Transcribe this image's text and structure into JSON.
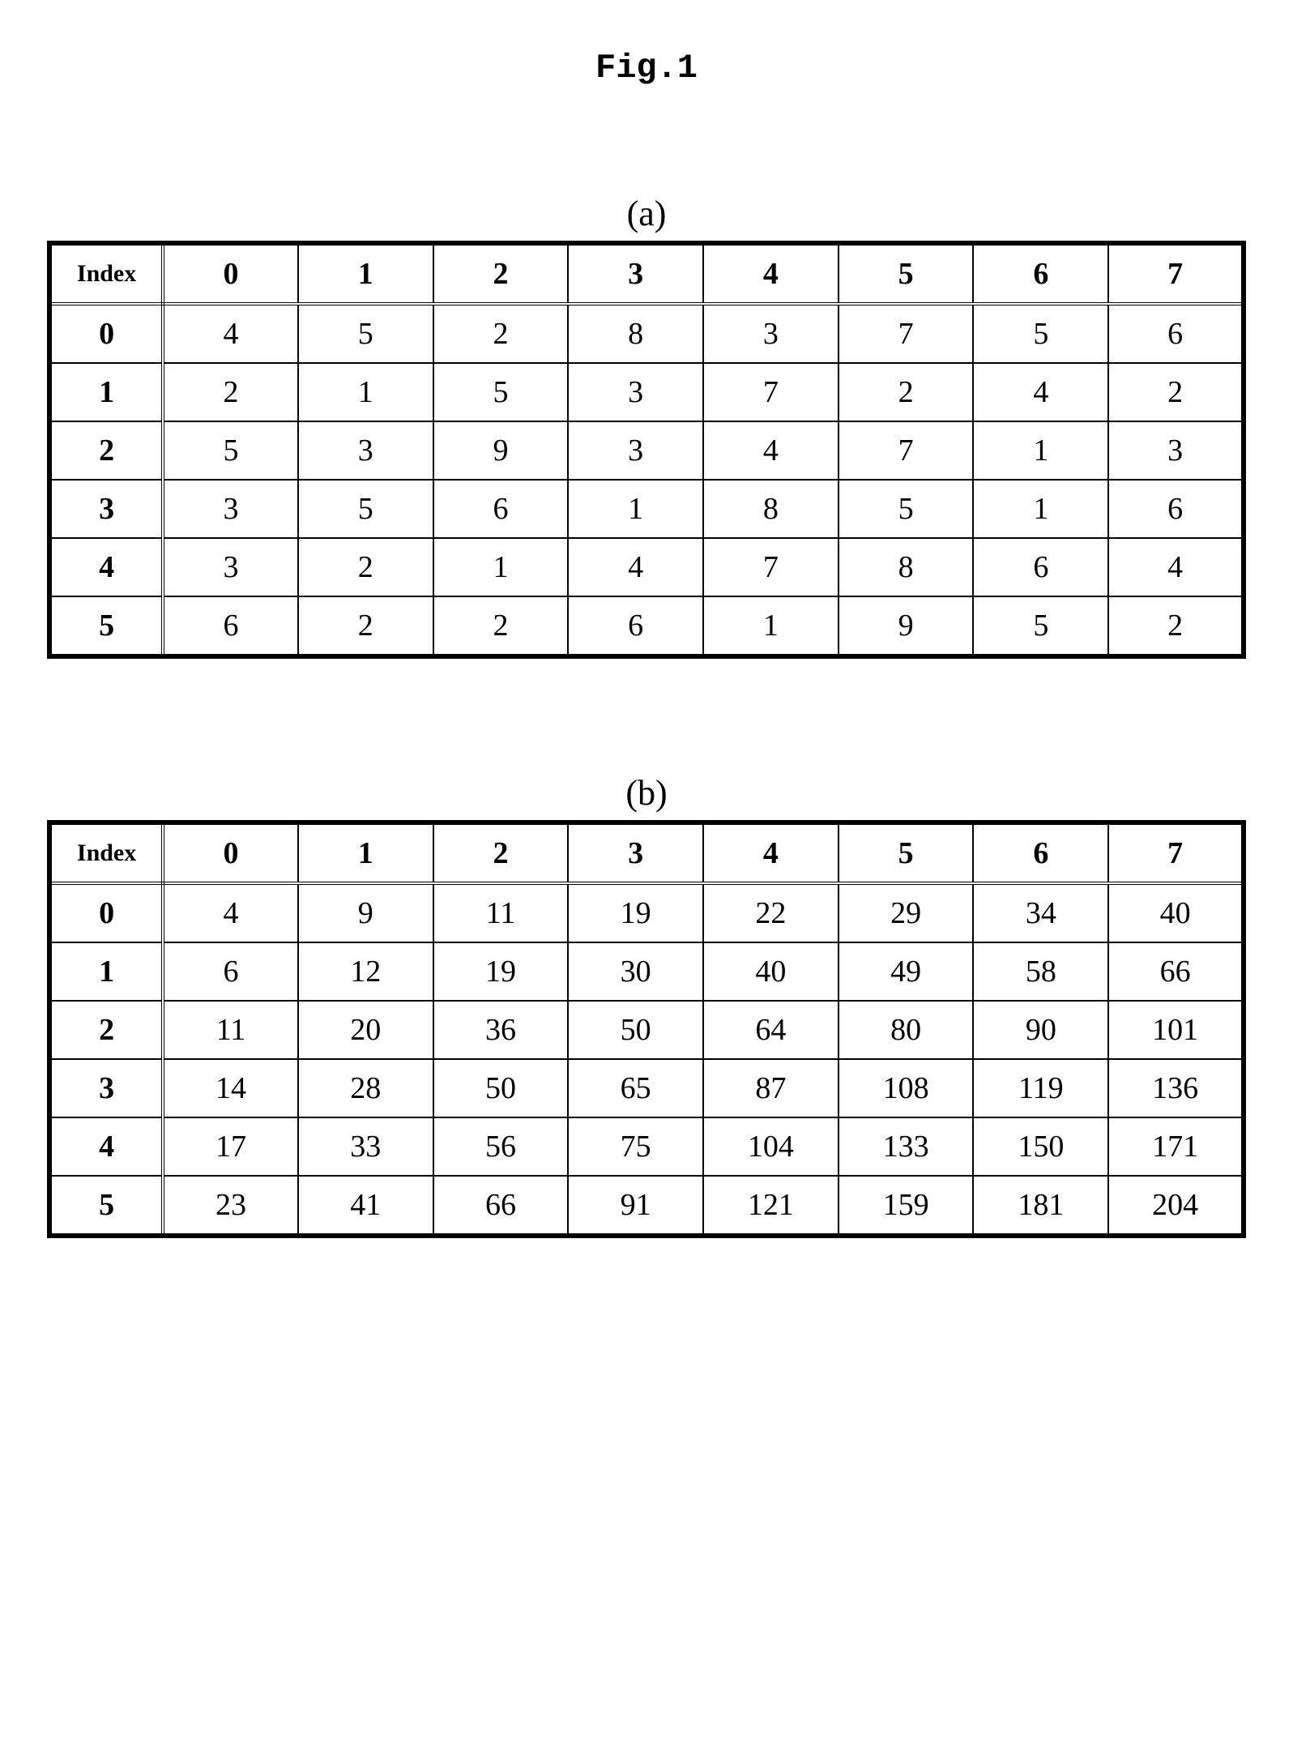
{
  "figure_title": "Fig.1",
  "chart_data": [
    {
      "type": "table",
      "label": "(a)",
      "corner_label": "Index",
      "col_headers": [
        "0",
        "1",
        "2",
        "3",
        "4",
        "5",
        "6",
        "7"
      ],
      "row_headers": [
        "0",
        "1",
        "2",
        "3",
        "4",
        "5"
      ],
      "rows": [
        [
          "4",
          "5",
          "2",
          "8",
          "3",
          "7",
          "5",
          "6"
        ],
        [
          "2",
          "1",
          "5",
          "3",
          "7",
          "2",
          "4",
          "2"
        ],
        [
          "5",
          "3",
          "9",
          "3",
          "4",
          "7",
          "1",
          "3"
        ],
        [
          "3",
          "5",
          "6",
          "1",
          "8",
          "5",
          "1",
          "6"
        ],
        [
          "3",
          "2",
          "1",
          "4",
          "7",
          "8",
          "6",
          "4"
        ],
        [
          "6",
          "2",
          "2",
          "6",
          "1",
          "9",
          "5",
          "2"
        ]
      ]
    },
    {
      "type": "table",
      "label": "(b)",
      "corner_label": "Index",
      "col_headers": [
        "0",
        "1",
        "2",
        "3",
        "4",
        "5",
        "6",
        "7"
      ],
      "row_headers": [
        "0",
        "1",
        "2",
        "3",
        "4",
        "5"
      ],
      "rows": [
        [
          "4",
          "9",
          "11",
          "19",
          "22",
          "29",
          "34",
          "40"
        ],
        [
          "6",
          "12",
          "19",
          "30",
          "40",
          "49",
          "58",
          "66"
        ],
        [
          "11",
          "20",
          "36",
          "50",
          "64",
          "80",
          "90",
          "101"
        ],
        [
          "14",
          "28",
          "50",
          "65",
          "87",
          "108",
          "119",
          "136"
        ],
        [
          "17",
          "33",
          "56",
          "75",
          "104",
          "133",
          "150",
          "171"
        ],
        [
          "23",
          "41",
          "66",
          "91",
          "121",
          "159",
          "181",
          "204"
        ]
      ]
    }
  ]
}
